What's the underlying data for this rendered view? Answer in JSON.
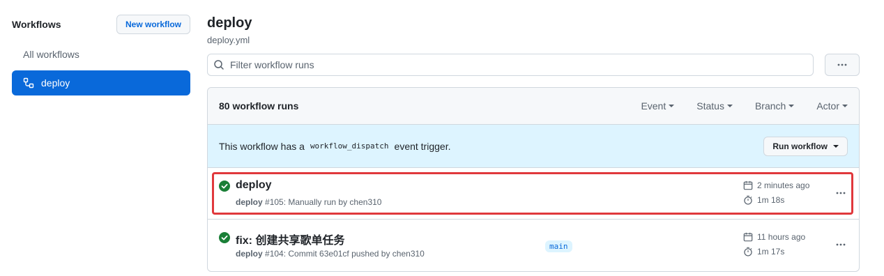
{
  "sidebar": {
    "title": "Workflows",
    "new_workflow_label": "New workflow",
    "items": [
      {
        "label": "All workflows",
        "active": false
      },
      {
        "label": "deploy",
        "active": true
      }
    ]
  },
  "main": {
    "title": "deploy",
    "subtitle": "deploy.yml",
    "search_placeholder": "Filter workflow runs",
    "runs_count": "80 workflow runs",
    "filters": [
      "Event",
      "Status",
      "Branch",
      "Actor"
    ],
    "dispatch": {
      "text_before": "This workflow has a",
      "code": "workflow_dispatch",
      "text_after": "event trigger.",
      "button_label": "Run workflow"
    },
    "runs": [
      {
        "title": "deploy",
        "workflow": "deploy",
        "meta": "#105: Manually run by chen310",
        "branch": "",
        "time": "2 minutes ago",
        "duration": "1m 18s",
        "status": "success",
        "highlighted": true
      },
      {
        "title": "fix: 创建共享歌单任务",
        "workflow": "deploy",
        "meta": "#104: Commit 63e01cf pushed by chen310",
        "branch": "main",
        "time": "11 hours ago",
        "duration": "1m 17s",
        "status": "success",
        "highlighted": false
      }
    ]
  },
  "colors": {
    "accent": "#0969da",
    "success": "#1a7f37",
    "highlight_border": "#e0383c",
    "banner_bg": "#ddf4ff"
  }
}
